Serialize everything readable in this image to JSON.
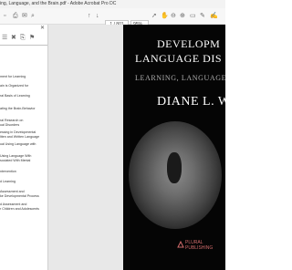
{
  "window": {
    "title": "ing, Language, and the Brain.pdf - Adobe Acrobat Pro DC"
  },
  "toolbar": {
    "page_indicator": "1 / 801",
    "zoom": "95%"
  },
  "navigation_pane": {
    "bookmarks": [
      "ment for Learning",
      "ain is Organized for",
      "ral Basis of Learning",
      "ating the Brain-Behavior",
      "ral Research on",
      "ual Disorders",
      "essing in Developmental",
      "ltten and Written Language",
      "ual Using Language with",
      "Using Language With",
      "sociated With Mental",
      "ntervention",
      "d Learning",
      "Assessment and",
      "ke Developmental Process",
      "d Assessment and",
      "r Children and Adolescents"
    ]
  },
  "cover": {
    "title_line1": "DEVELOPM",
    "title_line2": "LANGUAGE DIS",
    "subtitle": "LEARNING, LANGUAGE, A",
    "author": "DIANE L. WI",
    "publisher_line1": "PLURAL",
    "publisher_line2": "PUBLISHING"
  },
  "colors": {
    "publisher_accent": "#d06a6a",
    "cover_background": "#050505"
  }
}
